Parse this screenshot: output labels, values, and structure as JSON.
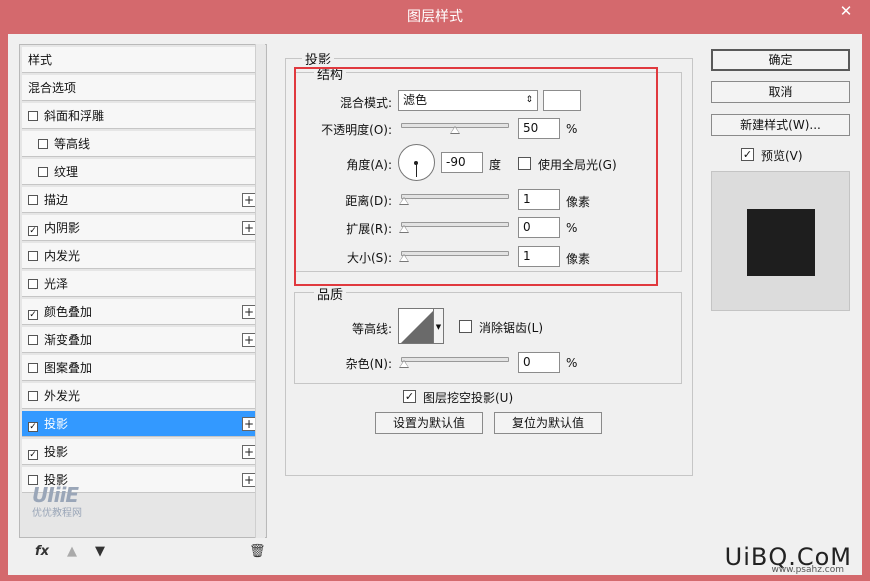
{
  "window": {
    "title": "图层样式",
    "close": "✕"
  },
  "left_list": {
    "items": [
      {
        "label": "样式",
        "checkbox": false,
        "checked": false,
        "plus": false,
        "sub": false,
        "selected": false
      },
      {
        "label": "混合选项",
        "checkbox": false,
        "checked": false,
        "plus": false,
        "sub": false,
        "selected": false
      },
      {
        "label": "斜面和浮雕",
        "checkbox": true,
        "checked": false,
        "plus": false,
        "sub": false,
        "selected": false
      },
      {
        "label": "等高线",
        "checkbox": true,
        "checked": false,
        "plus": false,
        "sub": true,
        "selected": false
      },
      {
        "label": "纹理",
        "checkbox": true,
        "checked": false,
        "plus": false,
        "sub": true,
        "selected": false
      },
      {
        "label": "描边",
        "checkbox": true,
        "checked": false,
        "plus": true,
        "sub": false,
        "selected": false
      },
      {
        "label": "内阴影",
        "checkbox": true,
        "checked": true,
        "plus": true,
        "sub": false,
        "selected": false
      },
      {
        "label": "内发光",
        "checkbox": true,
        "checked": false,
        "plus": false,
        "sub": false,
        "selected": false
      },
      {
        "label": "光泽",
        "checkbox": true,
        "checked": false,
        "plus": false,
        "sub": false,
        "selected": false
      },
      {
        "label": "颜色叠加",
        "checkbox": true,
        "checked": true,
        "plus": true,
        "sub": false,
        "selected": false
      },
      {
        "label": "渐变叠加",
        "checkbox": true,
        "checked": false,
        "plus": true,
        "sub": false,
        "selected": false
      },
      {
        "label": "图案叠加",
        "checkbox": true,
        "checked": false,
        "plus": false,
        "sub": false,
        "selected": false
      },
      {
        "label": "外发光",
        "checkbox": true,
        "checked": false,
        "plus": false,
        "sub": false,
        "selected": false
      },
      {
        "label": "投影",
        "checkbox": true,
        "checked": true,
        "plus": true,
        "sub": false,
        "selected": true
      },
      {
        "label": "投影",
        "checkbox": true,
        "checked": true,
        "plus": true,
        "sub": false,
        "selected": false
      },
      {
        "label": "投影",
        "checkbox": true,
        "checked": false,
        "plus": true,
        "sub": false,
        "selected": false
      }
    ],
    "footer_fx": "fx",
    "watermark_logo": "UIiiE",
    "watermark_text": "优优教程网"
  },
  "shadow": {
    "title": "投影",
    "structure": {
      "title": "结构",
      "blend_mode_label": "混合模式:",
      "blend_mode_value": "滤色",
      "blend_color": "#ffffff",
      "opacity_label": "不透明度(O):",
      "opacity_value": "50",
      "opacity_unit": "%",
      "opacity_fraction": 0.5,
      "angle_label": "角度(A):",
      "angle_value": "-90",
      "angle_unit": "度",
      "global_light_label": "使用全局光(G)",
      "distance_label": "距离(D):",
      "distance_value": "1",
      "distance_unit": "像素",
      "spread_label": "扩展(R):",
      "spread_value": "0",
      "spread_unit": "%",
      "size_label": "大小(S):",
      "size_value": "1",
      "size_unit": "像素"
    },
    "quality": {
      "title": "品质",
      "contour_label": "等高线:",
      "antialias_label": "消除锯齿(L)",
      "noise_label": "杂色(N):",
      "noise_value": "0",
      "noise_unit": "%"
    },
    "knockout_label": "图层挖空投影(U)",
    "make_default": "设置为默认值",
    "reset_default": "复位为默认值"
  },
  "right": {
    "ok": "确定",
    "cancel": "取消",
    "new_style": "新建样式(W)...",
    "preview_label": "预览(V)",
    "preview_swatch": "#1e1e1e"
  },
  "brand": {
    "name": "UiBQ.CoM",
    "url": "www.psahz.com"
  },
  "colors": {
    "title_bar": "#d4696d",
    "selection": "#3399ff",
    "highlight": "#e0393e"
  }
}
